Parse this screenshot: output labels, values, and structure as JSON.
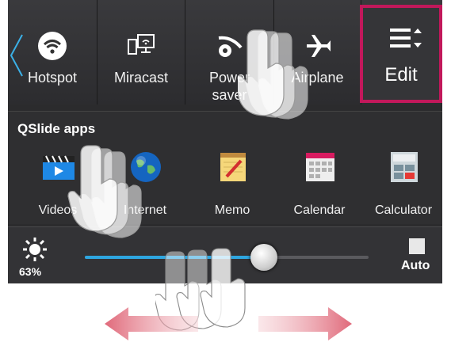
{
  "quick_settings": {
    "items": [
      {
        "label": "Hotspot",
        "icon": "wifi-hotspot-icon"
      },
      {
        "label": "Miracast",
        "icon": "miracast-icon"
      },
      {
        "label": "Power\nsaver",
        "icon": "power-saver-icon"
      },
      {
        "label": "Airplane",
        "icon": "airplane-icon"
      }
    ],
    "edit_label": "Edit",
    "highlight_color": "#c2185b"
  },
  "qslide": {
    "title": "QSlide apps",
    "apps": [
      {
        "label": "Videos",
        "icon": "videos-icon"
      },
      {
        "label": "Internet",
        "icon": "internet-globe-icon"
      },
      {
        "label": "Memo",
        "icon": "memo-icon"
      },
      {
        "label": "Calendar",
        "icon": "calendar-icon"
      },
      {
        "label": "Calculator",
        "icon": "calculator-icon"
      }
    ]
  },
  "brightness": {
    "percent_label": "63%",
    "level": 0.63,
    "auto_label": "Auto",
    "accent": "#2ea6e0"
  }
}
